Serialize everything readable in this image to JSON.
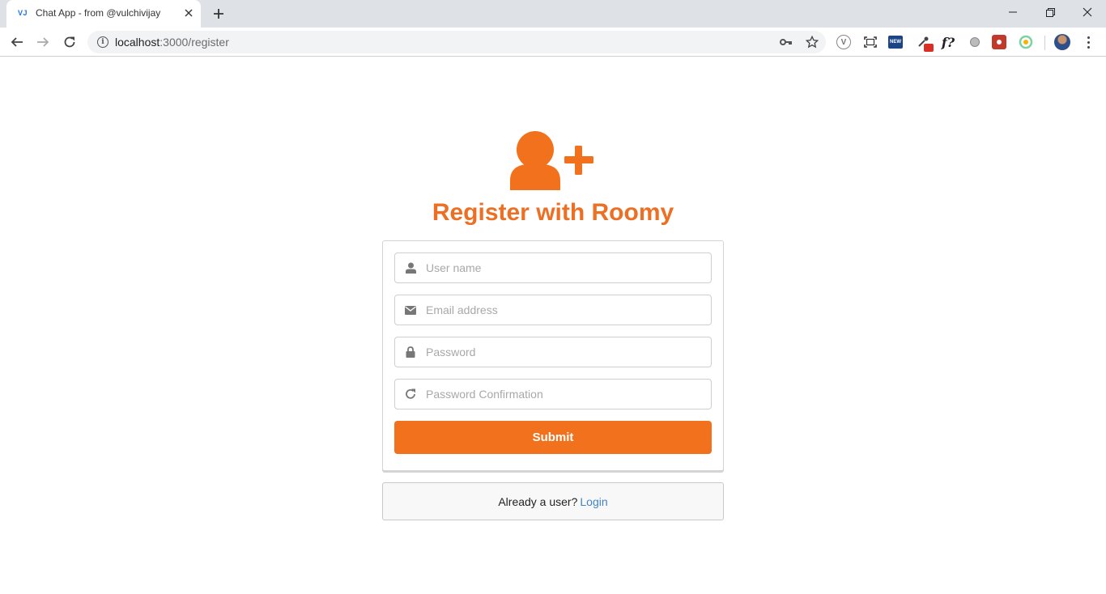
{
  "browser": {
    "tab_favicon": "VJ",
    "tab_title": "Chat App - from @vulchivijay",
    "url_host": "localhost",
    "url_path": ":3000/register"
  },
  "page": {
    "title": "Register with Roomy",
    "accent_color": "#f2711c"
  },
  "form": {
    "username": {
      "placeholder": "User name",
      "value": "",
      "icon": "user-icon"
    },
    "email": {
      "placeholder": "Email address",
      "value": "",
      "icon": "envelope-icon"
    },
    "password": {
      "placeholder": "Password",
      "value": "",
      "icon": "lock-icon"
    },
    "password_confirmation": {
      "placeholder": "Password Confirmation",
      "value": "",
      "icon": "refresh-icon"
    },
    "submit_label": "Submit"
  },
  "footer": {
    "prompt": "Already a user?",
    "login_label": "Login"
  }
}
